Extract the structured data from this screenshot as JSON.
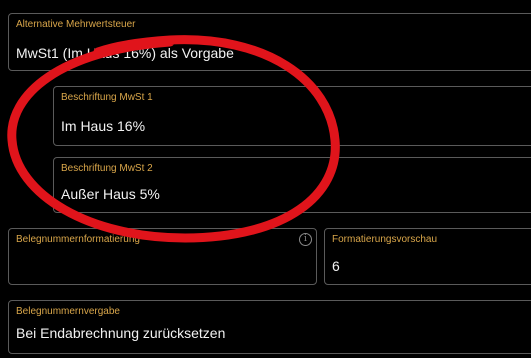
{
  "fields": {
    "mwst_select": {
      "label": "Alternative Mehrwertsteuer",
      "value": "MwSt1 (Im Haus 16%) als Vorgabe"
    },
    "label_mwst1": {
      "label": "Beschriftung MwSt 1",
      "value": "Im Haus 16%"
    },
    "label_mwst2": {
      "label": "Beschriftung MwSt 2",
      "value": "Außer Haus 5%"
    },
    "belegnummer_format": {
      "label": "Belegnummernformatierung",
      "value": ""
    },
    "format_preview": {
      "label": "Formatierungsvorschau",
      "value": "6"
    },
    "belegnummer_vergabe": {
      "label": "Belegnummernvergabe",
      "value": "Bei Endabrechnung zurücksetzen"
    }
  },
  "icons": {
    "info": "info-icon"
  },
  "colors": {
    "background": "#000000",
    "label": "#d9a64a",
    "value_text": "#f2f2f2",
    "field_border": "#5a5a5a",
    "annotation": "#e0141b"
  }
}
